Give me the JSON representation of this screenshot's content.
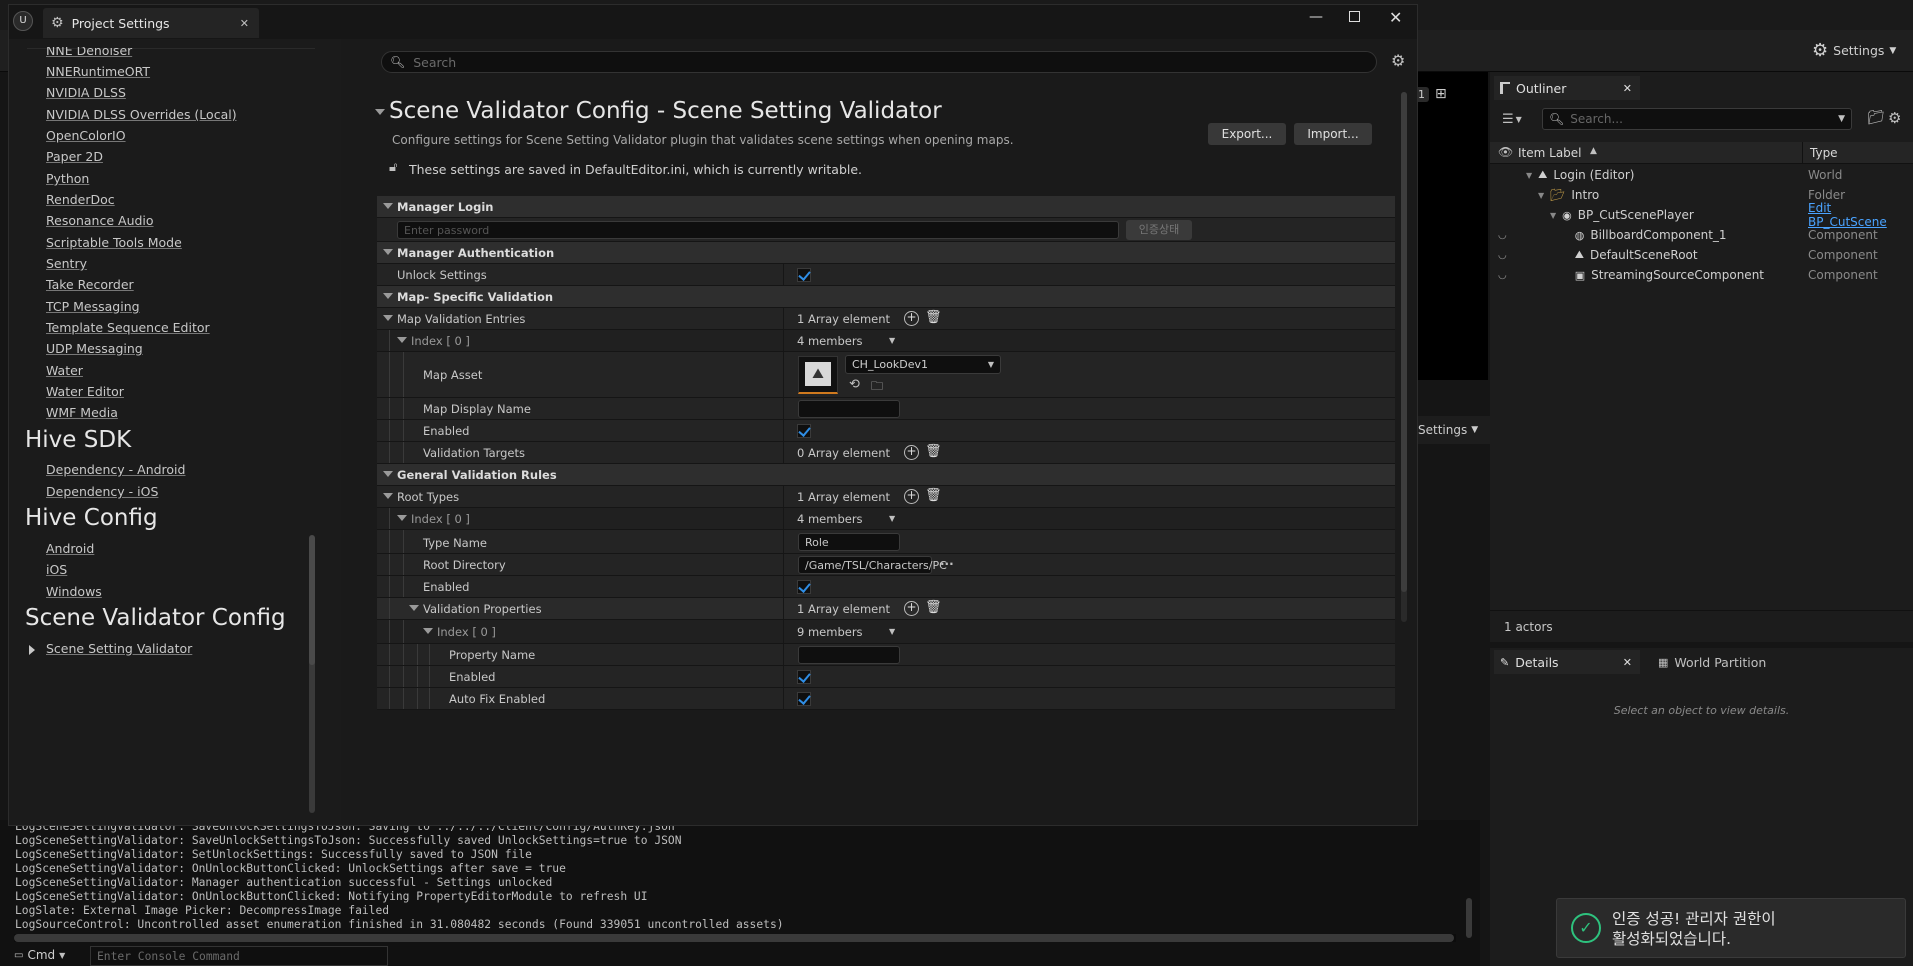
{
  "editor": {
    "settings_label": "Settings",
    "viewport_badge": "1",
    "settings2_label": "Settings"
  },
  "outliner": {
    "tab": "Outliner",
    "search_placeholder": "Search...",
    "col_label": "Item Label",
    "col_type": "Type",
    "rows": [
      {
        "label": "Login (Editor)",
        "type": "World"
      },
      {
        "label": "Intro",
        "type": "Folder"
      },
      {
        "label": "BP_CutScenePlayer",
        "type": "Edit BP_CutScene"
      },
      {
        "label": "BillboardComponent_1",
        "type": "Component"
      },
      {
        "label": "DefaultSceneRoot",
        "type": "Component"
      },
      {
        "label": "StreamingSourceComponent",
        "type": "Component"
      }
    ],
    "actors_count": "1 actors"
  },
  "details": {
    "tab": "Details",
    "tab2": "World Partition",
    "empty_msg": "Select an object to view details."
  },
  "console": {
    "lines": [
      "LogSceneSettingValidator: SaveUnlockSettingsToJson: Saving to ../../../Client/Config/AuthKey.json",
      "LogSceneSettingValidator: SaveUnlockSettingsToJson: Successfully saved UnlockSettings=true to JSON",
      "LogSceneSettingValidator: SetUnlockSettings: Successfully saved to JSON file",
      "LogSceneSettingValidator: OnUnlockButtonClicked: UnlockSettings after save = true",
      "LogSceneSettingValidator: Manager authentication successful - Settings unlocked",
      "LogSceneSettingValidator: OnUnlockButtonClicked: Notifying PropertyEditorModule to refresh UI",
      "LogSlate: External Image Picker: DecompressImage failed",
      "LogSourceControl: Uncontrolled asset enumeration finished in 31.080482 seconds (Found 339051 uncontrolled assets)"
    ],
    "cmd_label": "Cmd",
    "cmd_placeholder": "Enter Console Command"
  },
  "toast": {
    "line1": "인증 성공! 관리자 권한이",
    "line2": "활성화되었습니다."
  },
  "window": {
    "title": "Project Settings"
  },
  "nav": {
    "links_top": [
      "NNE Denoiser",
      "NNERuntimeORT",
      "NVIDIA DLSS",
      "NVIDIA DLSS Overrides (Local)",
      "OpenColorIO",
      "Paper 2D",
      "Python",
      "RenderDoc",
      "Resonance Audio",
      "Scriptable Tools Mode",
      "Sentry",
      "Take Recorder",
      "TCP Messaging",
      "Template Sequence Editor",
      "UDP Messaging",
      "Water",
      "Water Editor",
      "WMF Media"
    ],
    "hive_sdk": "Hive SDK",
    "hive_sdk_links": [
      "Dependency - Android",
      "Dependency - iOS"
    ],
    "hive_config": "Hive Config",
    "hive_config_links": [
      "Android",
      "iOS",
      "Windows"
    ],
    "scene_validator": "Scene Validator Config",
    "scene_validator_link": "Scene Setting Validator"
  },
  "content": {
    "search_placeholder": "Search",
    "title": "Scene Validator Config - Scene Setting Validator",
    "description": "Configure settings for Scene Setting Validator plugin that validates scene settings when opening maps.",
    "export_label": "Export...",
    "import_label": "Import...",
    "writable_note": "These settings are saved in DefaultEditor.ini, which is currently writable.",
    "manager_login": "Manager Login",
    "password_placeholder": "Enter password",
    "auth_status": "인증상태",
    "manager_auth": "Manager Authentication",
    "unlock_settings": "Unlock Settings",
    "map_specific": "Map- Specific Validation",
    "map_entries": "Map Validation Entries",
    "one_array": "1 Array element",
    "zero_array": "0 Array element",
    "index0": "Index [ 0 ]",
    "four_members": "4 members",
    "nine_members": "9 members",
    "map_asset": "Map Asset",
    "map_asset_value": "CH_LookDev1",
    "map_display_name": "Map Display Name",
    "enabled": "Enabled",
    "validation_targets": "Validation Targets",
    "general_rules": "General Validation Rules",
    "root_types": "Root Types",
    "type_name": "Type Name",
    "type_name_value": "Role",
    "root_directory": "Root Directory",
    "root_directory_value": "/Game/TSL/Characters/PC",
    "validation_properties": "Validation Properties",
    "property_name": "Property Name",
    "auto_fix": "Auto Fix Enabled"
  },
  "colors": {
    "accent": "#2f8de4",
    "toast_check": "#2ec27e"
  }
}
